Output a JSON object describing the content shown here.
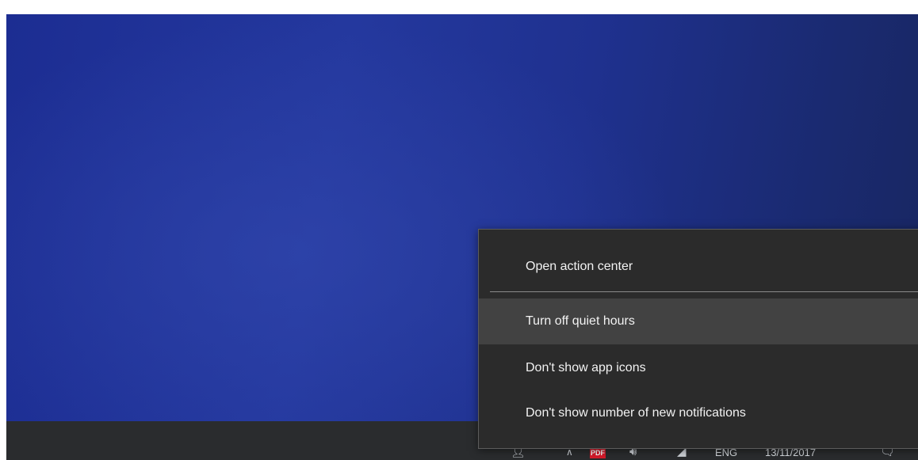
{
  "desktop": {
    "wallpaper_colors": [
      "#1c2d92",
      "#24389e",
      "#182660"
    ]
  },
  "context_menu": {
    "items": [
      {
        "label": "Open action center"
      },
      {
        "label": "Turn off quiet hours",
        "highlighted": true
      },
      {
        "label": "Don't show app icons"
      },
      {
        "label": "Don't show number of new notifications"
      }
    ]
  },
  "taskbar": {
    "color": "#2a2c2e",
    "tray": {
      "people_icon": "person-icon",
      "show_hidden_icon": "chevron-up-icon",
      "pdf_app_icon": "adobe-acrobat-icon",
      "volume_icon": "speaker-icon",
      "network_icon": "wifi-icon",
      "language": "ENG",
      "clock": "13/11/2017",
      "notification_icon": "action-center-icon"
    }
  }
}
